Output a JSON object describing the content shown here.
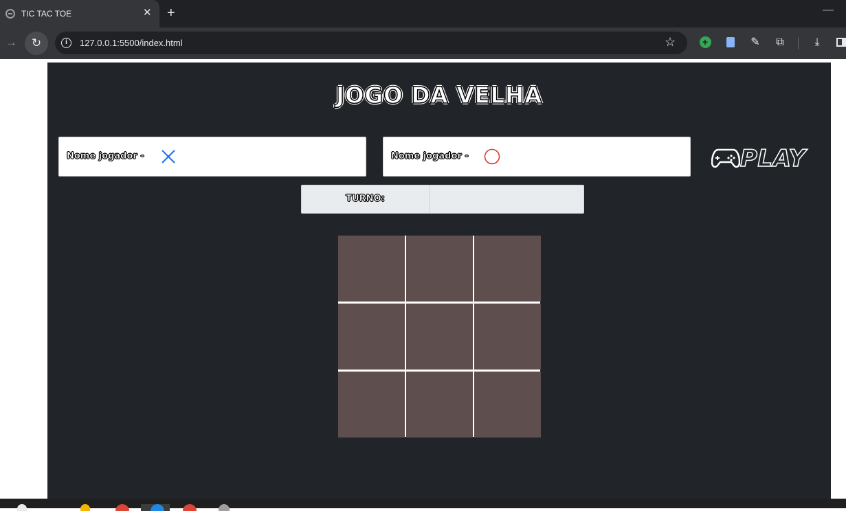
{
  "browser": {
    "tab_title": "TIC TAC TOE",
    "tab_close": "✕",
    "new_tab": "+",
    "minimize": "—",
    "url": "127.0.0.1:5500/index.html",
    "info": "i"
  },
  "game": {
    "title": "JOGO DA VELHA",
    "players": [
      {
        "label": "Nome jogador -",
        "mark": "X",
        "mark_color": "#1a73e8",
        "value": ""
      },
      {
        "label": "Nome jogador -",
        "mark": "O",
        "mark_color": "#d93025",
        "value": ""
      }
    ],
    "play_label": "PLAY",
    "turn_label": "TURNO:",
    "turn_value": "",
    "board": [
      "",
      "",
      "",
      "",
      "",
      "",
      "",
      "",
      ""
    ]
  },
  "colors": {
    "app_background": "#212428",
    "cell": "#5e4f4e",
    "grid_lines": "#ffffff"
  }
}
